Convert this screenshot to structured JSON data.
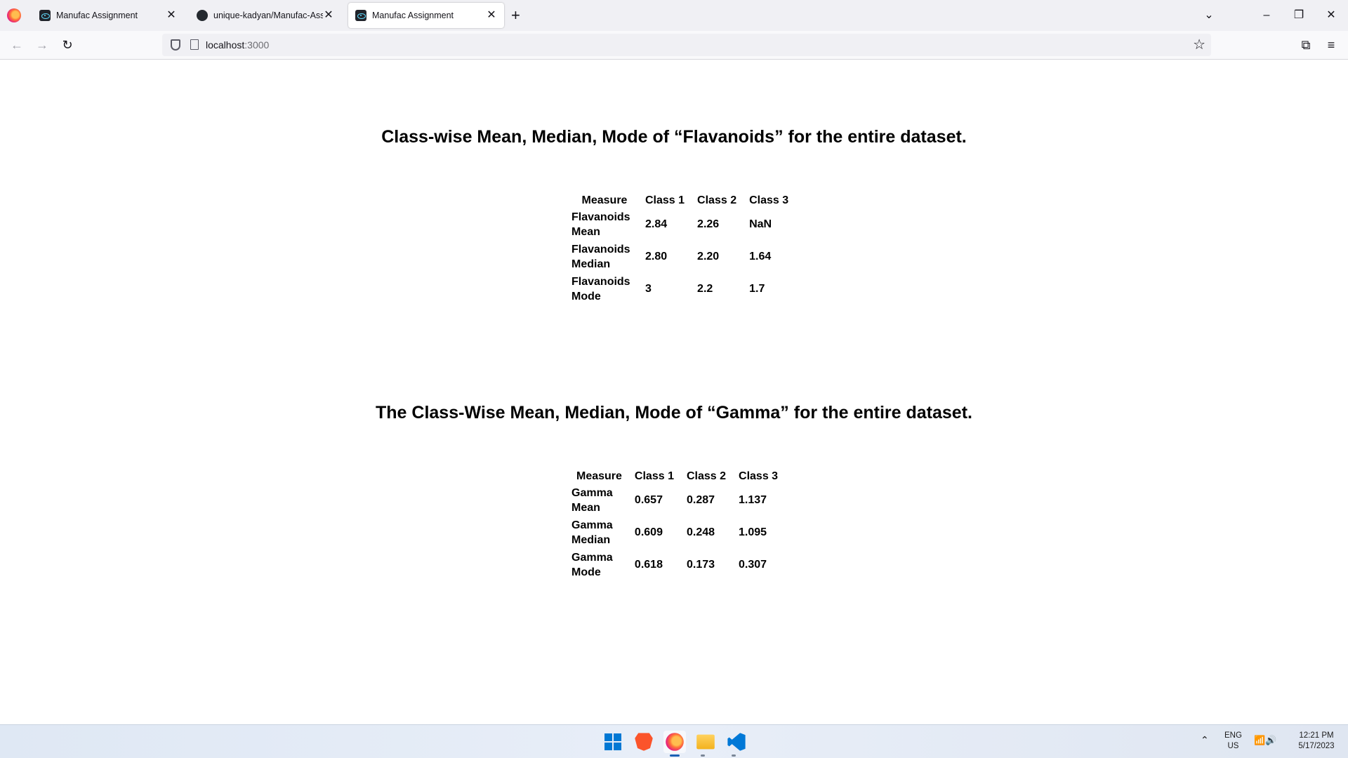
{
  "browser": {
    "tabs": [
      {
        "title": "Manufac Assignment",
        "icon": "react-icon",
        "active": false
      },
      {
        "title": "unique-kadyan/Manufac-Assig",
        "icon": "github-icon",
        "active": false
      },
      {
        "title": "Manufac Assignment",
        "icon": "react-icon",
        "active": true
      }
    ],
    "close_glyph": "✕",
    "new_tab_glyph": "+",
    "url_host": "localhost",
    "url_port": ":3000"
  },
  "flavanoids": {
    "title": "Class-wise Mean, Median, Mode of “Flavanoids” for the entire dataset.",
    "headers": [
      "Measure",
      "Class 1",
      "Class 2",
      "Class 3"
    ],
    "rows": [
      {
        "measure": "Flavanoids Mean",
        "values": [
          "2.84",
          "2.26",
          "NaN"
        ]
      },
      {
        "measure": "Flavanoids Median",
        "values": [
          "2.80",
          "2.20",
          "1.64"
        ]
      },
      {
        "measure": "Flavanoids Mode",
        "values": [
          "3",
          "2.2",
          "1.7"
        ]
      }
    ]
  },
  "gamma": {
    "title": "The Class-Wise Mean, Median, Mode of “Gamma” for the entire dataset.",
    "headers": [
      "Measure",
      "Class 1",
      "Class 2",
      "Class 3"
    ],
    "rows": [
      {
        "measure": "Gamma Mean",
        "values": [
          "0.657",
          "0.287",
          "1.137"
        ]
      },
      {
        "measure": "Gamma Median",
        "values": [
          "0.609",
          "0.248",
          "1.095"
        ]
      },
      {
        "measure": "Gamma Mode",
        "values": [
          "0.618",
          "0.173",
          "0.307"
        ]
      }
    ]
  },
  "taskbar": {
    "apps": [
      "windows-start-icon",
      "brave-icon",
      "firefox-icon",
      "file-explorer-icon",
      "vscode-icon"
    ],
    "lang_line1": "ENG",
    "lang_line2": "US",
    "time": "12:21 PM",
    "date": "5/17/2023"
  }
}
